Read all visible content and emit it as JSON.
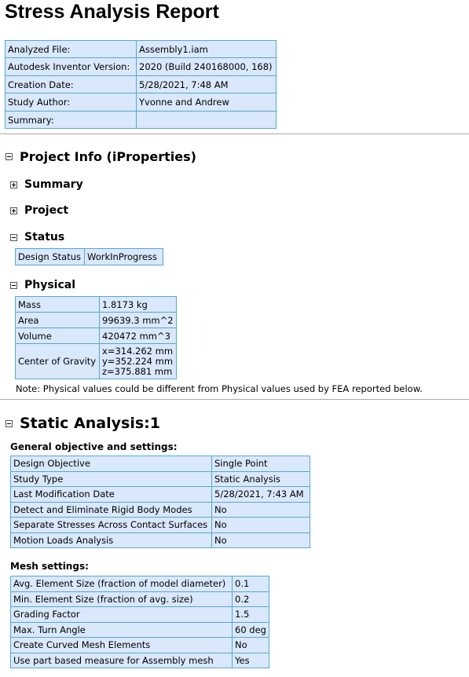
{
  "report_title": "Stress Analysis Report",
  "file_info": [
    {
      "label": "Analyzed File:",
      "value": "Assembly1.iam"
    },
    {
      "label": "Autodesk Inventor Version:",
      "value": "2020 (Build 240168000, 168)"
    },
    {
      "label": "Creation Date:",
      "value": "5/28/2021, 7:48 AM"
    },
    {
      "label": "Study Author:",
      "value": "Yvonne and Andrew"
    },
    {
      "label": "Summary:",
      "value": ""
    }
  ],
  "project_info": {
    "title": "Project Info (iProperties)",
    "summary_title": "Summary",
    "project_title": "Project",
    "status_title": "Status",
    "status_rows": [
      {
        "label": "Design Status",
        "value": "WorkInProgress"
      }
    ],
    "physical_title": "Physical",
    "physical_rows": [
      {
        "label": "Mass",
        "value": "1.8173 kg"
      },
      {
        "label": "Area",
        "value": "99639.3 mm^2"
      },
      {
        "label": "Volume",
        "value": "420472 mm^3"
      }
    ],
    "center_of_gravity": {
      "label": "Center of Gravity",
      "x": "x=314.262 mm",
      "y": "y=352.224 mm",
      "z": "z=375.881 mm"
    },
    "note": "Note: Physical values could be different from Physical values used by FEA reported below."
  },
  "static_analysis": {
    "title": "Static Analysis:1",
    "general_heading": "General objective and settings:",
    "general_rows": [
      {
        "label": "Design Objective",
        "value": "Single Point"
      },
      {
        "label": "Study Type",
        "value": "Static Analysis"
      },
      {
        "label": "Last Modification Date",
        "value": "5/28/2021, 7:43 AM"
      },
      {
        "label": "Detect and Eliminate Rigid Body Modes",
        "value": "No"
      },
      {
        "label": "Separate Stresses Across Contact Surfaces",
        "value": "No"
      },
      {
        "label": "Motion Loads Analysis",
        "value": "No"
      }
    ],
    "mesh_heading": "Mesh settings:",
    "mesh_rows": [
      {
        "label": "Avg. Element Size (fraction of model diameter)",
        "value": "0.1"
      },
      {
        "label": "Min. Element Size (fraction of avg. size)",
        "value": "0.2"
      },
      {
        "label": "Grading Factor",
        "value": "1.5"
      },
      {
        "label": "Max. Turn Angle",
        "value": "60 deg"
      },
      {
        "label": "Create Curved Mesh Elements",
        "value": "No"
      },
      {
        "label": "Use part based measure for Assembly mesh",
        "value": "Yes"
      }
    ]
  }
}
